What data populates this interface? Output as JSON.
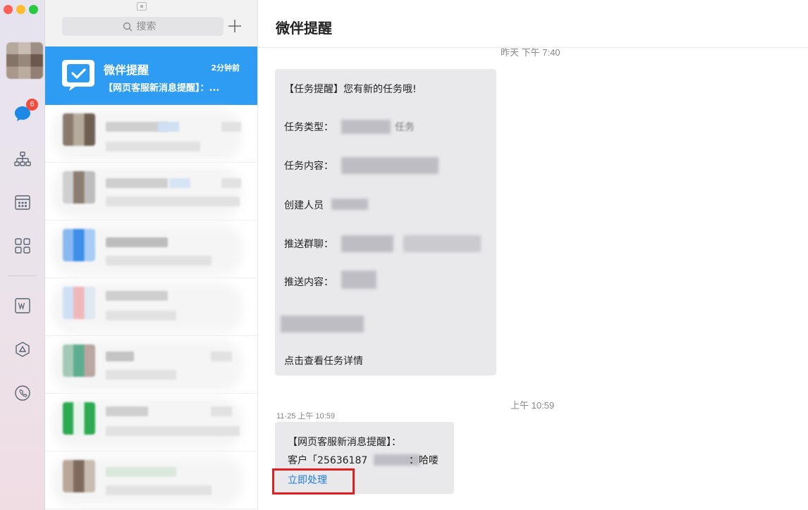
{
  "window": {
    "traffic_lights": [
      "close",
      "minimize",
      "zoom"
    ]
  },
  "rail": {
    "messages_badge": "6",
    "icons": [
      "messages-icon",
      "org-chart-icon",
      "calendar-icon",
      "apps-grid-icon",
      "w-doc-icon",
      "drive-icon",
      "phone-icon"
    ]
  },
  "list": {
    "search": {
      "placeholder": "搜索"
    },
    "add_label": "+",
    "active": {
      "name": "微伴提醒",
      "time": "2分钟前",
      "preview": "【网页客服新消息提醒】：..."
    }
  },
  "chat": {
    "title": "微伴提醒",
    "top_timestamp": "昨天 下午 7:40",
    "card1": {
      "header": "【任务提醒】您有新的任务哦!",
      "task_type_label": "任务类型：",
      "task_type_suffix": "任务",
      "task_content_label": "任务内容：",
      "creator_label": "创建人员",
      "push_group_label": "推送群聊：",
      "push_content_label": "推送内容：",
      "link": "点击查看任务详情"
    },
    "mid_timestamp": "上午 10:59",
    "card2_timestamp": "11-25 上午 10:59",
    "card2": {
      "line1": "【网页客服新消息提醒】：",
      "line2_prefix": "客户「25636187",
      "line2_suffix": "：哈喽",
      "action": "立即处理"
    }
  }
}
